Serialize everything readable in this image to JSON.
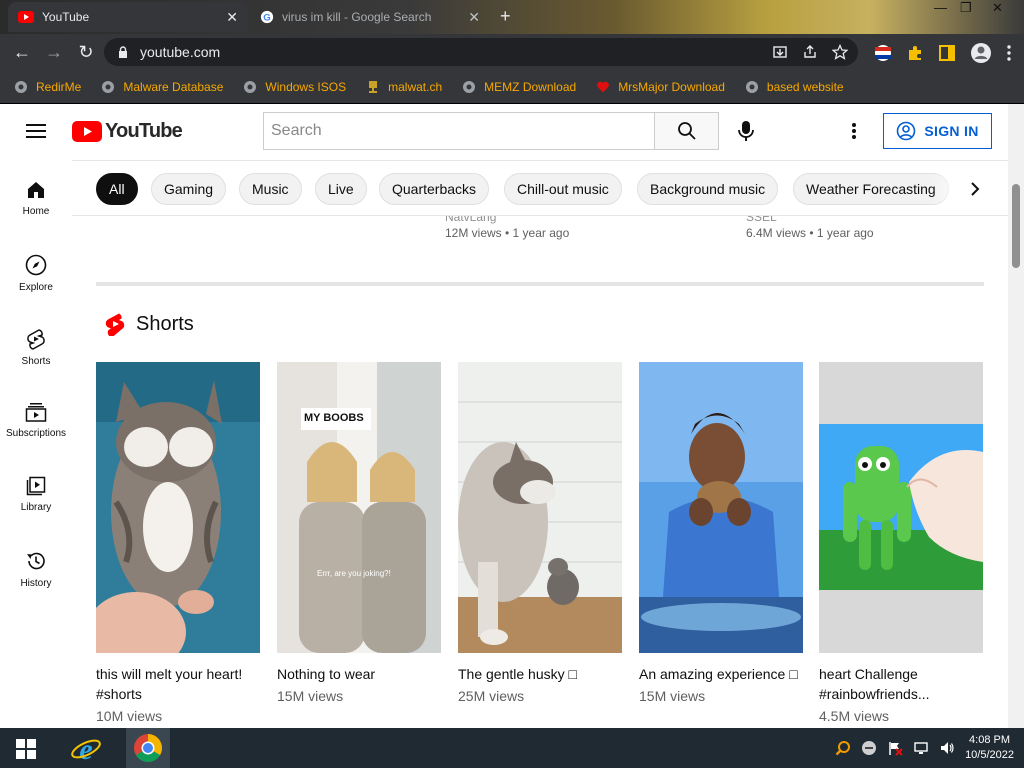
{
  "browser": {
    "tabs": [
      {
        "title": "YouTube",
        "active": true
      },
      {
        "title": "virus im kill - Google Search",
        "active": false
      }
    ],
    "address": "youtube.com",
    "bookmarks": [
      "RedirMe",
      "Malware Database",
      "Windows ISOS",
      "malwat.ch",
      "MEMZ Download",
      "MrsMajor Download",
      "based website"
    ]
  },
  "youtube": {
    "logo_text": "YouTube",
    "search_placeholder": "Search",
    "signin_label": "SIGN IN",
    "chips": [
      "All",
      "Gaming",
      "Music",
      "Live",
      "Quarterbacks",
      "Chill-out music",
      "Background music",
      "Weather Forecasting"
    ],
    "guide": [
      "Home",
      "Explore",
      "Shorts",
      "Subscriptions",
      "Library",
      "History"
    ],
    "above_meta": [
      {
        "channel": "NatvLang",
        "meta": "12M views • 1 year ago"
      },
      {
        "channel": "SSEL",
        "meta": "6.4M views • 1 year ago"
      }
    ],
    "shorts_heading": "Shorts",
    "shorts": [
      {
        "title": "this will melt your heart! #shorts",
        "views": "10M views",
        "overlay": ""
      },
      {
        "title": "Nothing to wear",
        "views": "15M views",
        "overlay": "MY BOOBS"
      },
      {
        "title": "The gentle husky □",
        "views": "25M views",
        "overlay": ""
      },
      {
        "title": "An amazing experience □",
        "views": "15M views",
        "overlay": ""
      },
      {
        "title": "heart Challenge #rainbowfriends...",
        "views": "4.5M views",
        "overlay": ""
      }
    ],
    "colors": {
      "brand_red": "#ff0000",
      "link_blue": "#065fd4"
    }
  },
  "taskbar": {
    "time": "4:08 PM",
    "date": "10/5/2022"
  }
}
